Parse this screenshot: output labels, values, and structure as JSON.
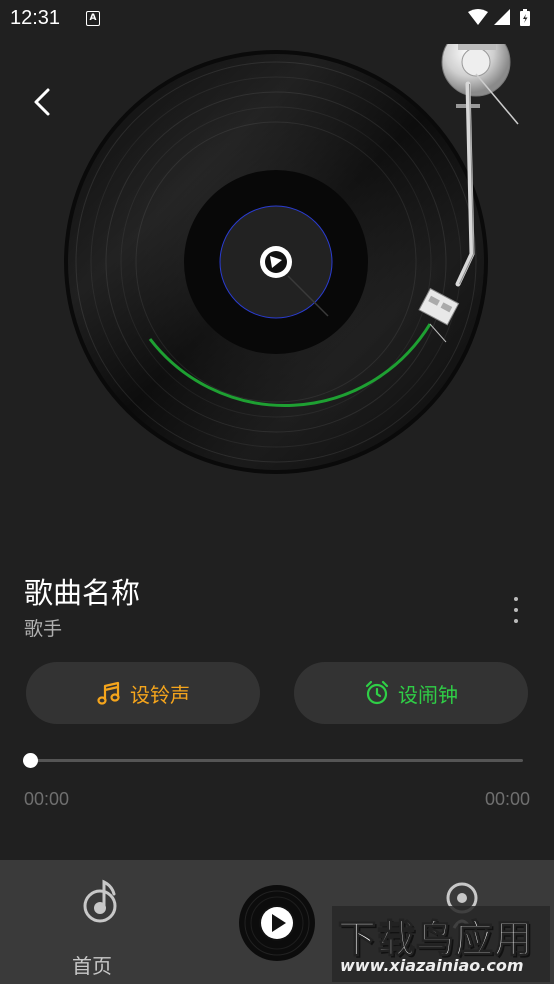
{
  "status_bar": {
    "time": "12:31",
    "notification_icon": "A"
  },
  "player": {
    "song_title": "歌曲名称",
    "singer": "歌手",
    "ringtone_label": "设铃声",
    "alarm_label": "设闹钟",
    "current_time": "00:00",
    "total_time": "00:00",
    "progress": 0
  },
  "nav": {
    "home_label": "首页"
  },
  "watermark": {
    "main": "下载鸟应用",
    "url": "www.xiazainiao.com"
  },
  "colors": {
    "background": "#202020",
    "ringtone": "#f5a51c",
    "alarm": "#2fcf46",
    "nav_bg": "#3a3a3a"
  },
  "icons": [
    "back-icon",
    "music-note-icon",
    "alarm-clock-icon",
    "more-vert-icon",
    "music-note-circle-icon",
    "play-icon",
    "wifi-icon",
    "signal-icon",
    "battery-icon"
  ]
}
